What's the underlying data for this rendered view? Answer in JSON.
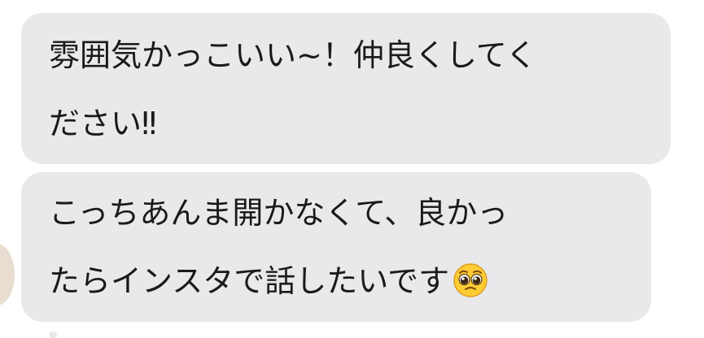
{
  "messages": [
    {
      "lines": [
        "雰囲気かっこいい~！仲良くしてく",
        "ださい‼︎"
      ]
    },
    {
      "lines": [
        "こっちあんま開かなくて、良かっ",
        "たらインスタで話したいです"
      ],
      "emoji": "pleading-face-icon"
    }
  ],
  "colors": {
    "bubble_bg": "#e9e9eb",
    "text": "#1a1a1a",
    "page_bg": "#ffffff"
  }
}
